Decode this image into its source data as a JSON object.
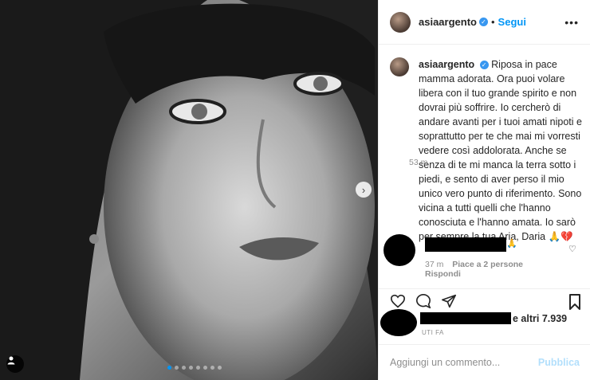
{
  "post": {
    "username": "asiaargento",
    "verified_badge": "✓",
    "separator": "•",
    "follow_label": "Segui",
    "more_icon": "more-horizontal-icon"
  },
  "caption": {
    "username": "asiaargento",
    "text": "Riposa in pace mamma adorata. Ora puoi volare libera con il tuo grande spirito e non dovrai più soffrire. Io cercherò di andare avanti per i tuoi amati nipoti e soprattutto per te che mai mi vorresti vedere così addolorata. Anche se senza di te mi manca la terra sotto i piedi, e sento di aver perso il mio unico vero punto di riferimento. Sono vicina a tutti quelli che l'hanno conosciuta e l'hanno amata. Io sarò per sempre la tua Aria, Daria 🙏💔",
    "time": "53 m"
  },
  "comment": {
    "emoji": "🙏",
    "time": "37 m",
    "likes": "Piace a 2 persone",
    "reply_label": "Rispondi"
  },
  "likes_row": {
    "text": "e altri 7.939",
    "ago": "UTI FA"
  },
  "add_comment": {
    "placeholder": "Aggiungi un commento...",
    "publish_label": "Pubblica"
  },
  "carousel": {
    "slide_count": 8,
    "active_index": 0
  },
  "colors": {
    "accent": "#0095f6",
    "publish_disabled": "#b2dffc",
    "muted": "#8e8e8e"
  }
}
